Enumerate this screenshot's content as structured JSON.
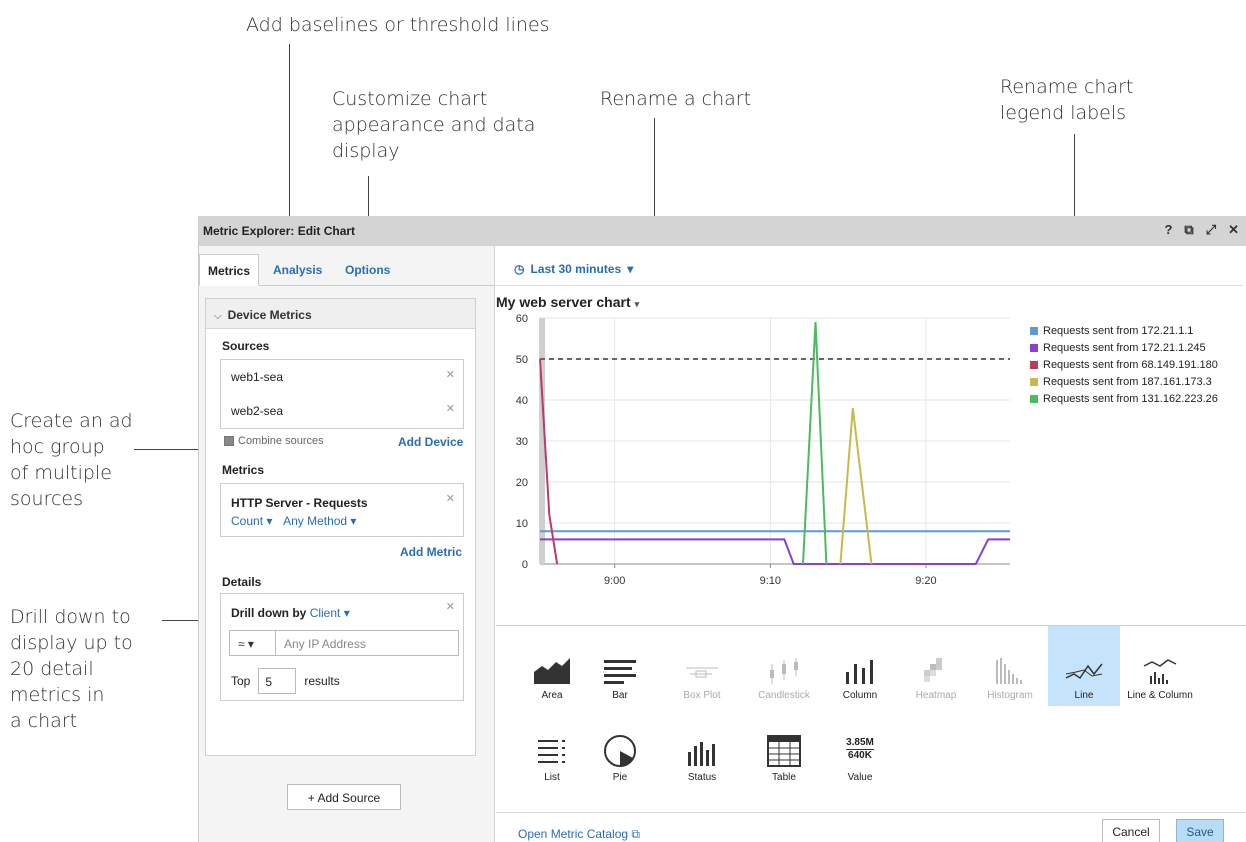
{
  "callouts": {
    "baselines": "Add baselines or threshold lines",
    "customize": [
      "Customize chart",
      "appearance and data",
      "display"
    ],
    "rename_chart": "Rename a chart",
    "rename_legend": [
      "Rename chart",
      "legend labels"
    ],
    "adhoc": [
      "Create an ad",
      "hoc group",
      "of multiple",
      "sources"
    ],
    "drilldown": [
      "Drill down to",
      "display up to",
      "20 detail",
      "metrics in",
      "a chart"
    ]
  },
  "window": {
    "title": "Metric Explorer: Edit Chart",
    "icons": [
      "help-icon",
      "external-link-icon",
      "expand-icon",
      "close-icon"
    ],
    "icon_glyphs": [
      "?",
      "⧉",
      "⤢",
      "✕"
    ]
  },
  "tabs": [
    "Metrics",
    "Analysis",
    "Options"
  ],
  "device_metrics": {
    "header": "Device Metrics",
    "sources_label": "Sources",
    "sources": [
      "web1-sea",
      "web2-sea"
    ],
    "combine_label": "Combine sources",
    "add_device": "Add Device",
    "metrics_label": "Metrics",
    "metric_name": "HTTP Server - Requests",
    "metric_count": "Count ▾",
    "metric_method": "Any Method ▾",
    "add_metric": "Add Metric",
    "details_label": "Details",
    "drill_prefix": "Drill down by",
    "drill_value": "Client ▾",
    "operator": "≈ ▾",
    "ip_placeholder": "Any IP Address",
    "top_label": "Top",
    "top_value": "5",
    "results_label": "results"
  },
  "add_source": "+ Add Source",
  "time_range": "Last 30 minutes",
  "chart_title": "My web server chart",
  "chart_data": {
    "type": "line",
    "ylim": [
      0,
      60
    ],
    "yticks": [
      0,
      10,
      20,
      30,
      40,
      50,
      60
    ],
    "xticks": [
      {
        "label": "9:00",
        "minute": 5
      },
      {
        "label": "9:10",
        "minute": 15
      },
      {
        "label": "9:20",
        "minute": 25
      }
    ],
    "xlim": [
      0.2,
      30.4
    ],
    "baseline": 50,
    "series": [
      {
        "name": "Requests sent from 172.21.1.1",
        "color": "#5b9bd5",
        "points": [
          [
            0.2,
            8
          ],
          [
            30.4,
            8
          ]
        ]
      },
      {
        "name": "Requests sent from 172.21.1.245",
        "color": "#8a3fd1",
        "points": [
          [
            0.2,
            6
          ],
          [
            15.9,
            6
          ],
          [
            16.5,
            0
          ],
          [
            28.2,
            0
          ],
          [
            29.0,
            6
          ],
          [
            30.4,
            6
          ]
        ]
      },
      {
        "name": "Requests sent from 68.149.191.180",
        "color": "#c0395f",
        "points": [
          [
            0.2,
            50
          ],
          [
            0.8,
            12
          ],
          [
            1.3,
            0
          ]
        ]
      },
      {
        "name": "Requests sent from 187.161.173.3",
        "color": "#c9b94a",
        "points": [
          [
            19.5,
            0
          ],
          [
            20.3,
            38
          ],
          [
            21.5,
            0
          ]
        ]
      },
      {
        "name": "Requests sent from 131.162.223.26",
        "color": "#4cbb5b",
        "points": [
          [
            17.1,
            0
          ],
          [
            17.9,
            59
          ],
          [
            18.6,
            0
          ]
        ]
      }
    ]
  },
  "chart_types": [
    {
      "label": "Area",
      "icon": "area-chart-icon",
      "disabled": false
    },
    {
      "label": "Bar",
      "icon": "bar-chart-icon",
      "disabled": false
    },
    {
      "label": "Box Plot",
      "icon": "box-plot-icon",
      "disabled": true
    },
    {
      "label": "Candlestick",
      "icon": "candlestick-icon",
      "disabled": true
    },
    {
      "label": "Column",
      "icon": "column-chart-icon",
      "disabled": false
    },
    {
      "label": "Heatmap",
      "icon": "heatmap-icon",
      "disabled": true
    },
    {
      "label": "Histogram",
      "icon": "histogram-icon",
      "disabled": true
    },
    {
      "label": "Line",
      "icon": "line-chart-icon",
      "disabled": false,
      "selected": true
    },
    {
      "label": "Line & Column",
      "icon": "line-column-icon",
      "disabled": false
    },
    {
      "label": "List",
      "icon": "list-icon",
      "disabled": false
    },
    {
      "label": "Pie",
      "icon": "pie-chart-icon",
      "disabled": false
    },
    {
      "label": "Status",
      "icon": "status-icon",
      "disabled": false
    },
    {
      "label": "Table",
      "icon": "table-icon",
      "disabled": false
    },
    {
      "label": "Value",
      "icon": "value-icon",
      "disabled": false,
      "value_top": "3.85M",
      "value_bottom": "640K"
    }
  ],
  "footer": {
    "catalog_link": "Open Metric Catalog",
    "cancel": "Cancel",
    "save": "Save"
  }
}
